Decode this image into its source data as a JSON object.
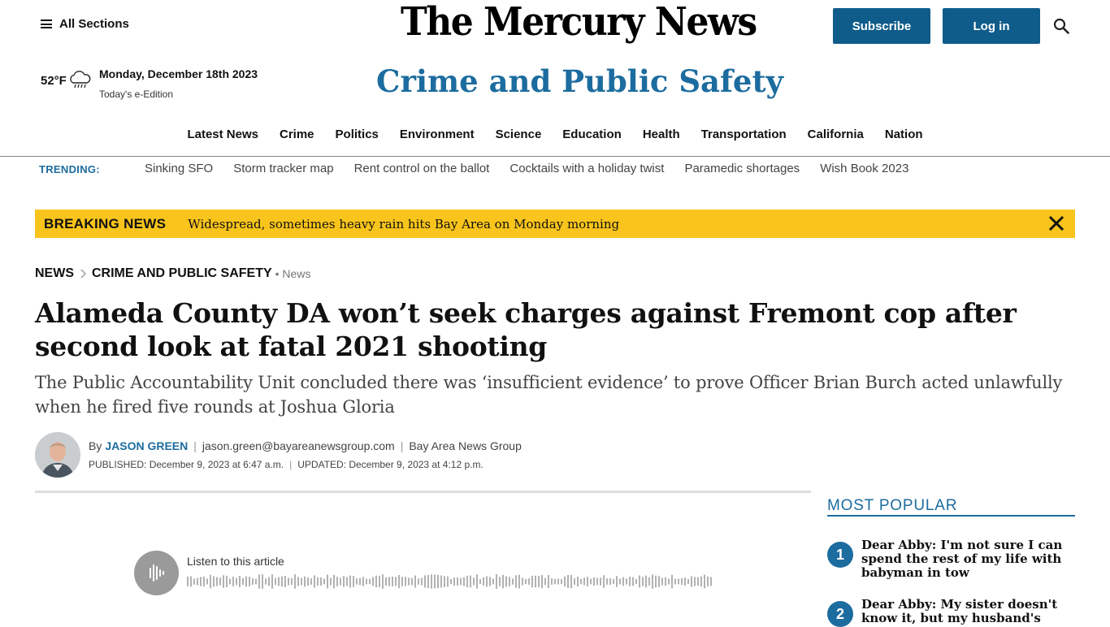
{
  "header": {
    "all_sections_label": "All Sections",
    "masthead": "The Mercury News",
    "subscribe_label": "Subscribe",
    "login_label": "Log in"
  },
  "weather": {
    "temperature": "52°F",
    "icon": "rain-cloud-icon",
    "date": "Monday, December 18th 2023",
    "eedition_label": "Today's e-Edition"
  },
  "section_title": "Crime and Public Safety",
  "nav": {
    "items": [
      "Latest News",
      "Crime",
      "Politics",
      "Environment",
      "Science",
      "Education",
      "Health",
      "Transportation",
      "California",
      "Nation"
    ]
  },
  "trending": {
    "label": "TRENDING:",
    "items": [
      "Sinking SFO",
      "Storm tracker map",
      "Rent control on the ballot",
      "Cocktails with a holiday twist",
      "Paramedic shortages",
      "Wish Book 2023"
    ]
  },
  "breaking": {
    "label": "BREAKING NEWS",
    "text": "Widespread, sometimes heavy rain hits Bay Area on Monday morning",
    "color": "#f9c41b"
  },
  "breadcrumb": {
    "root": "NEWS",
    "section": "CRIME AND PUBLIC SAFETY",
    "tag": "• News"
  },
  "article": {
    "headline": "Alameda County DA won’t seek charges against Fremont cop after second look at fatal 2021 shooting",
    "dek": "The Public Accountability Unit concluded there was ‘insufficient evidence’ to prove Officer Brian Burch acted unlawfully when he fired five rounds at Joshua Gloria",
    "by_prefix": "By",
    "author": "JASON GREEN",
    "email": "jason.green@bayareanewsgroup.com",
    "organization": "Bay Area News Group",
    "published": "PUBLISHED: December 9, 2023 at 6:47 a.m.",
    "updated": "UPDATED: December 9, 2023 at 4:12 p.m."
  },
  "audio": {
    "listen_label": "Listen to this article"
  },
  "most_popular": {
    "title": "MOST POPULAR",
    "items": [
      {
        "rank": "1",
        "title": "Dear Abby: I'm not sure I can spend the rest of my life with babyman in tow"
      },
      {
        "rank": "2",
        "title": "Dear Abby: My sister doesn't know it, but my husband's"
      }
    ]
  },
  "colors": {
    "brand_blue": "#1c6c9f",
    "button_blue": "#0f5c8a"
  }
}
